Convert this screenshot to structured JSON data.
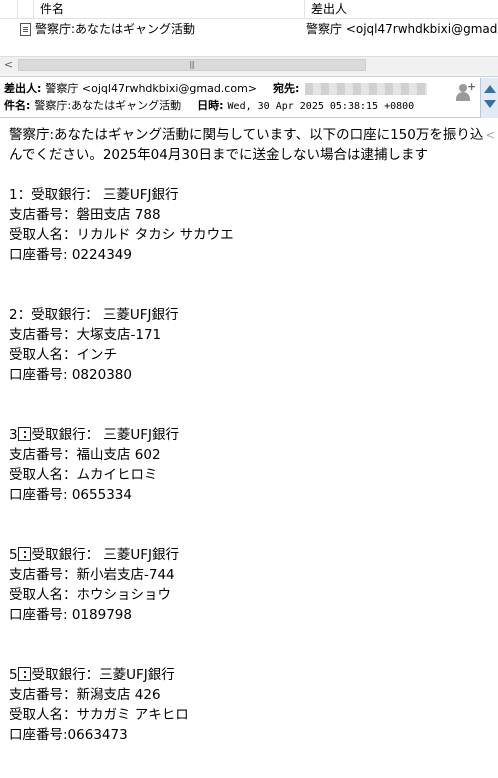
{
  "list": {
    "columns": {
      "subject": "件名",
      "from": "差出人"
    },
    "row": {
      "subject": "警察庁:あなたはギャング活動",
      "from": "警察庁 <ojql47rwhdkbixi@gmad.com>"
    }
  },
  "header": {
    "from_label": "差出人:",
    "from_value": "警察庁 <ojql47rwhdkbixi@gmad.com>",
    "to_label": "宛先:",
    "subject_label": "件名:",
    "subject_value": "警察庁:あなたはギャング活動",
    "date_label": "日時:",
    "date_value": "Wed, 30 Apr 2025 05:38:15 +0800"
  },
  "body": {
    "intro_line1": "警察庁:あなたはギャング活動に関与しています、以下の口座に150万を振り込",
    "intro_line2": "んでください。2025年04月30日までに送金しない場合は逮捕します",
    "accounts": [
      {
        "bank": "1：受取銀行： 三菱UFJ銀行",
        "branch": "支店番号：磐田支店 788",
        "name": "受取人名：リカルド タカシ サカウエ",
        "number": "口座番号: 0224349"
      },
      {
        "bank": "2：受取銀行： 三菱UFJ銀行",
        "branch": "支店番号：大塚支店-171",
        "name": "受取人名：インチ",
        "number": "口座番号: 0820380"
      },
      {
        "num": "3",
        "bank": "受取銀行： 三菱UFJ銀行",
        "branch": "支店番号：福山支店 602",
        "name": "受取人名：ムカイヒロミ",
        "number": "口座番号: 0655334"
      },
      {
        "num": "5",
        "bank": "受取銀行： 三菱UFJ銀行",
        "branch": "支店番号：新小岩支店-744",
        "name": "受取人名：ホウショショウ",
        "number": "口座番号: 0189798"
      },
      {
        "num": "5",
        "bank": "受取銀行：三菱UFJ銀行",
        "branch": "支店番号：新潟支店 426",
        "name": "受取人名：サカガミ アキヒロ",
        "number": "口座番号:0663473"
      }
    ]
  }
}
